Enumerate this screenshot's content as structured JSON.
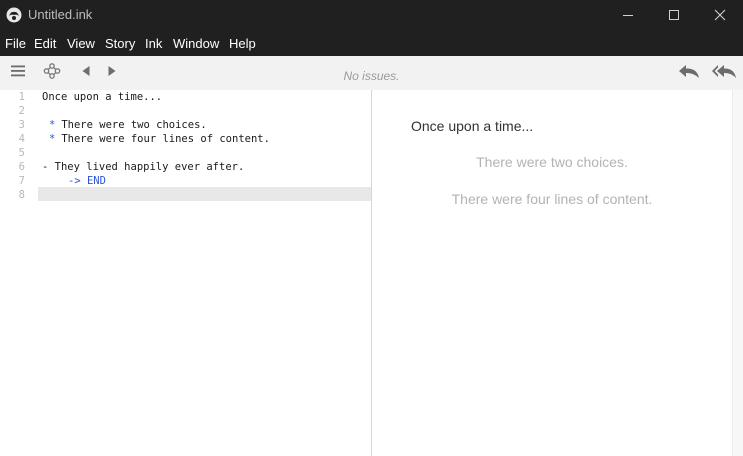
{
  "window": {
    "title": "Untitled.ink"
  },
  "menu": [
    "File",
    "Edit",
    "View",
    "Story",
    "Ink",
    "Window",
    "Help"
  ],
  "toolbar": {
    "status": "No issues."
  },
  "editor": {
    "line_numbers": [
      "1",
      "2",
      "3",
      "4",
      "5",
      "6",
      "7",
      "8"
    ],
    "lines": [
      "Once upon a time...",
      "",
      " There were two choices.",
      " There were four lines of content.",
      "",
      "- They lived happily ever after.",
      "",
      ""
    ],
    "bullet_glyph": "*",
    "divert_text": "-> END",
    "syntax_color": "#2a54d8"
  },
  "preview": {
    "story_text": "Once upon a time...",
    "choices": [
      "There were two choices.",
      "There were four lines of content."
    ]
  },
  "icons": [
    "app-logo-icon",
    "minimize-icon",
    "maximize-icon",
    "close-icon",
    "menu-icon",
    "story-nodes-icon",
    "back-arrow-icon",
    "forward-arrow-icon",
    "undo-icon",
    "restart-icon"
  ]
}
